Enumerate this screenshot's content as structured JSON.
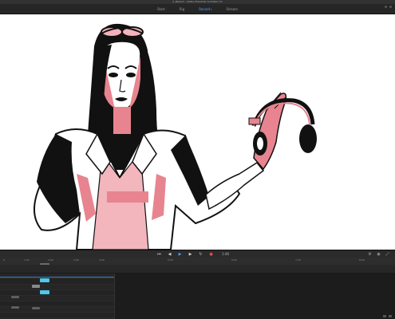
{
  "window": {
    "title": "2_Rewind - Adobe Character Animator CC"
  },
  "tabs": [
    {
      "label": "Start",
      "active": false
    },
    {
      "label": "Rig",
      "active": false
    },
    {
      "label": "Record",
      "active": true
    },
    {
      "label": "Stream",
      "active": false
    }
  ],
  "transport": {
    "frame_readout": "1:46"
  },
  "timeline": {
    "ruler_labels": [
      "0",
      "1:00",
      "2:00",
      "3:00",
      "4:00",
      "5:00",
      "6:00",
      "7:00",
      "8:00"
    ]
  },
  "colors": {
    "accent": "#4aa3ff",
    "record": "#e34b4b",
    "clip": "#4dc7ee",
    "pink": "#e8848f",
    "stage": "#ffffff"
  },
  "icons": {
    "tab_chevron": "chevron-down-icon",
    "transport": [
      "skip-back-icon",
      "step-back-icon",
      "play-icon",
      "step-forward-icon",
      "loop-icon",
      "record-icon"
    ]
  }
}
